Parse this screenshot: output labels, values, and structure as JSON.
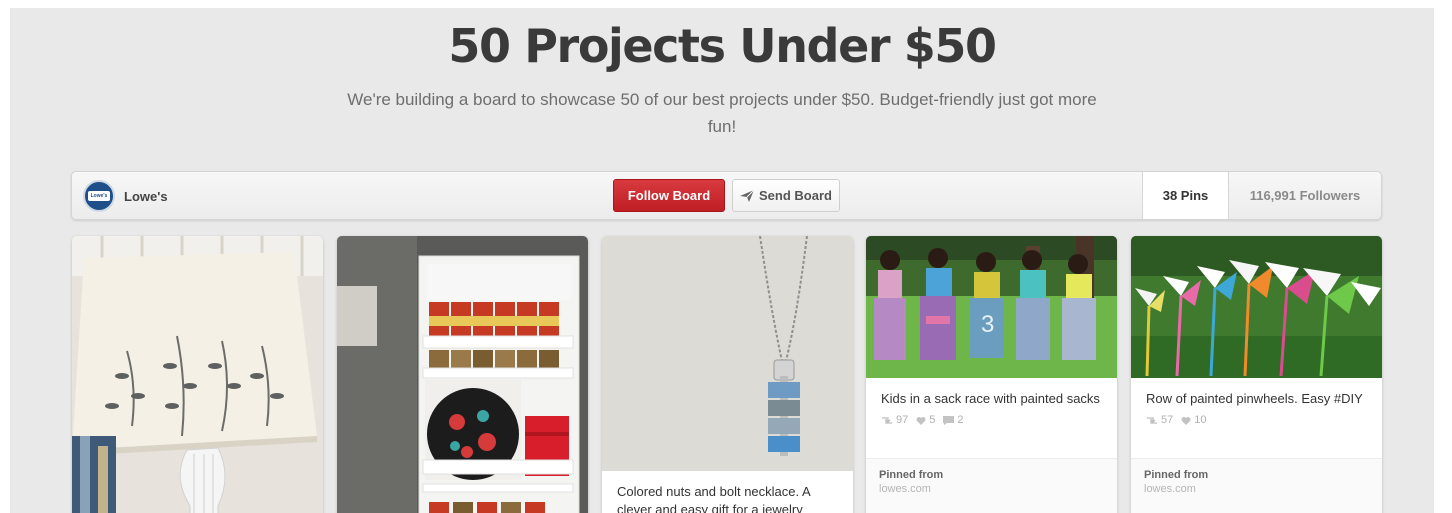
{
  "board": {
    "title": "50 Projects Under $50",
    "description": "We're building a board to showcase 50 of our best projects under $50. Budget-friendly just got more fun!"
  },
  "owner": {
    "name": "Lowe's",
    "avatar_text": "Lowe's"
  },
  "actions": {
    "follow_label": "Follow Board",
    "send_label": "Send Board"
  },
  "stats": {
    "pins": "38 Pins",
    "followers": "116,991 Followers"
  },
  "pins": [
    {
      "description": "",
      "image": "lamp-shade-leaf-stencil"
    },
    {
      "description": "",
      "image": "spice-rack-shelf"
    },
    {
      "description": "Colored nuts and bolt necklace. A clever and easy gift for a jewelry",
      "image": "nuts-bolt-necklace"
    },
    {
      "description": "Kids in a sack race with painted sacks",
      "repins": "97",
      "likes": "5",
      "comments": "2",
      "pinned_from_label": "Pinned from",
      "source": "lowes.com",
      "image": "kids-sack-race"
    },
    {
      "description": "Row of painted pinwheels. Easy #DIY",
      "repins": "57",
      "likes": "10",
      "pinned_from_label": "Pinned from",
      "source": "lowes.com",
      "image": "painted-pinwheels"
    }
  ],
  "colors": {
    "follow_button": "#c8242a",
    "background": "#e9e9e9"
  }
}
